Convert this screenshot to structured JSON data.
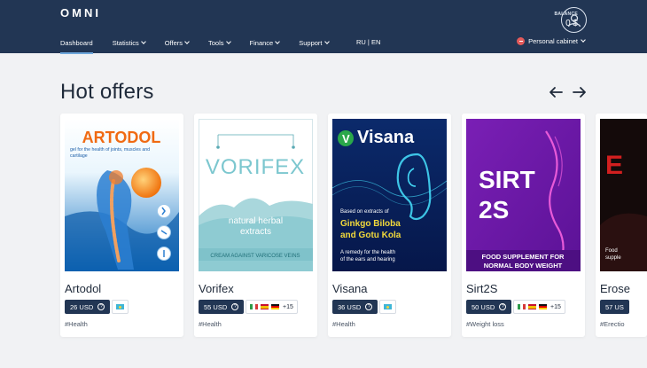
{
  "header": {
    "logo": "OMNI",
    "balance_label": "BALANCE",
    "balance_value": "0 $",
    "nav": [
      "Dashboard",
      "Statistics",
      "Offers",
      "Tools",
      "Finance",
      "Support"
    ],
    "lang": "RU | EN",
    "cabinet": "Personal cabinet"
  },
  "section": {
    "title": "Hot offers"
  },
  "offers": [
    {
      "name": "Artodol",
      "price": "26 USD",
      "tag": "#Health",
      "img_title": "ARTODOL",
      "img_sub": "gel for the health of joints, muscles and cartilage"
    },
    {
      "name": "Vorifex",
      "price": "55 USD",
      "more": "+15",
      "tag": "#Health",
      "img_title": "VORIFEX",
      "img_sub": "natural herbal extracts",
      "img_band": "CREAM AGAINST VARICOSE VEINS"
    },
    {
      "name": "Visana",
      "price": "36 USD",
      "tag": "#Health",
      "img_title": "Visana",
      "img_sub": "Based on extracts of",
      "img_hl1": "Ginkgo Biloba",
      "img_hl2": "and Gotu Kola",
      "img_foot1": "A remedy for the health",
      "img_foot2": "of the ears and hearing"
    },
    {
      "name": "Sirt2S",
      "price": "50 USD",
      "more": "+15",
      "tag": "#Weight loss",
      "img_title1": "SIRT",
      "img_title2": "2S",
      "img_foot1": "FOOD SUPPLEMENT FOR",
      "img_foot2": "NORMAL BODY WEIGHT"
    },
    {
      "name": "Erose",
      "price": "57 US",
      "tag": "#Erectio",
      "img_title": "E",
      "img_foot1": "Food",
      "img_foot2": "supple"
    }
  ]
}
